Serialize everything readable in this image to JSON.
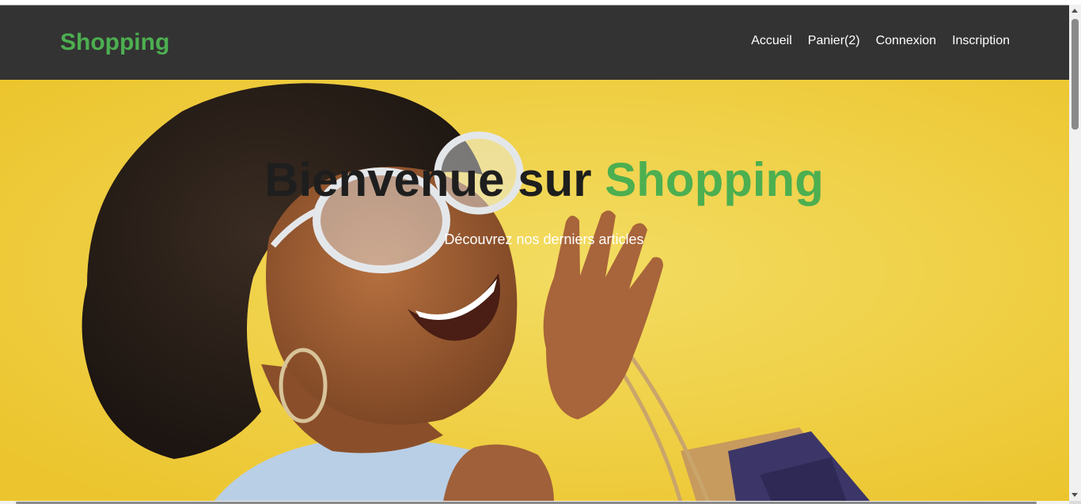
{
  "navbar": {
    "brand": "Shopping",
    "links": [
      "Accueil",
      "Panier(2)",
      "Connexion",
      "Inscription"
    ]
  },
  "hero": {
    "title_main": "Bienvenue sur ",
    "title_accent": "Shopping",
    "subtitle": "Découvrez nos derniers articles",
    "image_description": "hero-banner-woman-shopping-bags"
  },
  "colors": {
    "accent": "#4caf50",
    "navbar_bg": "#333333",
    "hero_bg": "#f0d34c",
    "title_text": "#1e1e1e",
    "link_text": "#ffffff"
  }
}
